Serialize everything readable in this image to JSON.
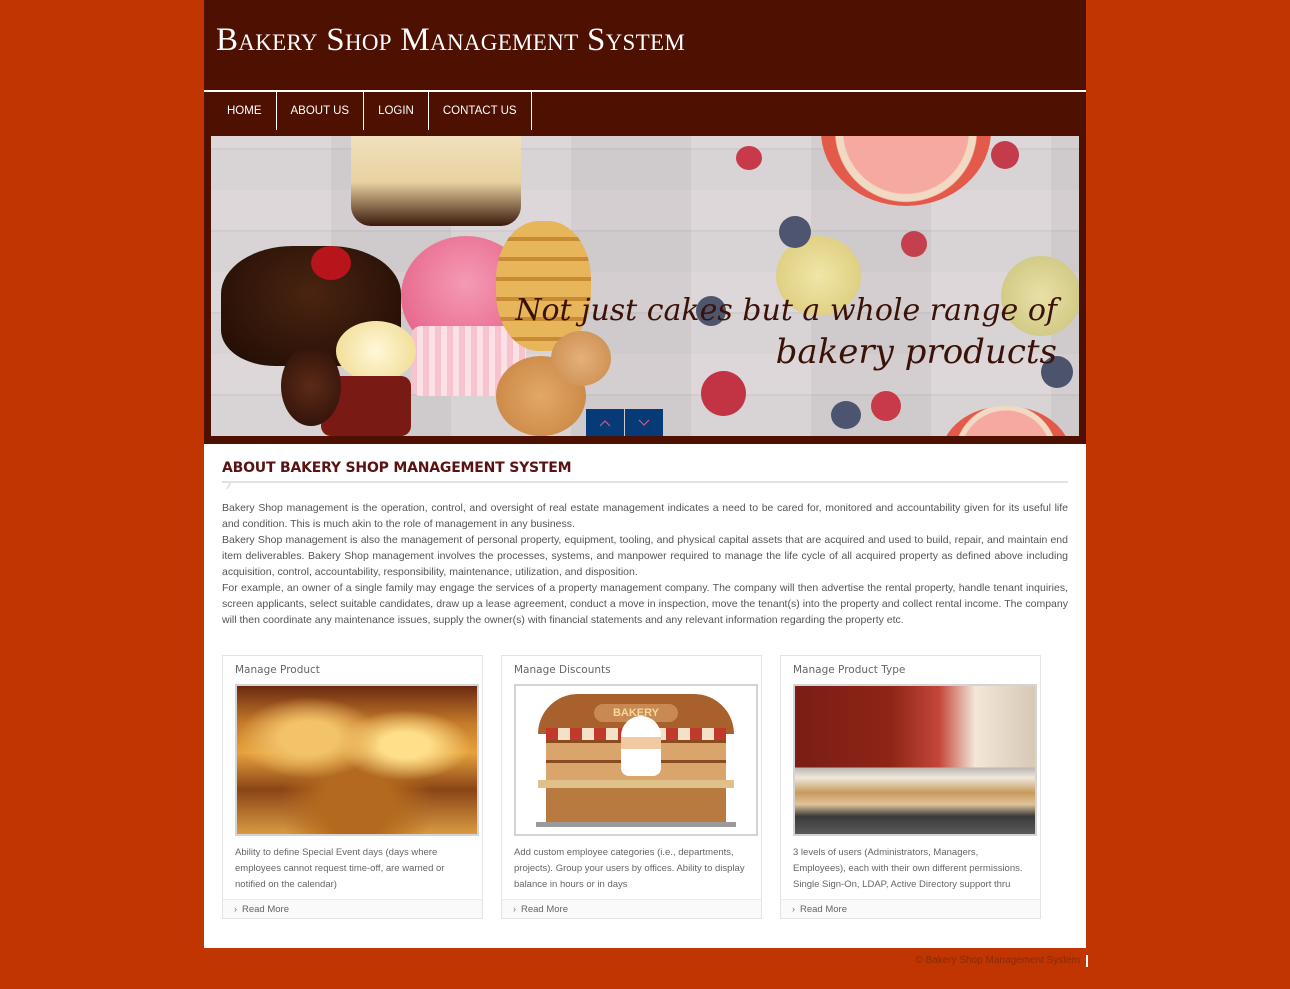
{
  "header": {
    "title": "Bakery Shop Management System"
  },
  "nav": {
    "items": [
      {
        "label": "HOME"
      },
      {
        "label": "ABOUT US"
      },
      {
        "label": "LOGIN"
      },
      {
        "label": "CONTACT US"
      }
    ]
  },
  "banner": {
    "caption_line1": "Not just cakes but a whole range of",
    "caption_line2": "bakery products",
    "prev_icon": "chevron-up-icon",
    "next_icon": "chevron-down-icon"
  },
  "about": {
    "title": "ABOUT BAKERY SHOP MANAGEMENT SYSTEM",
    "paragraphs": [
      "Bakery Shop management is the operation, control, and oversight of real estate management indicates a need to be cared for, monitored and accountability given for its useful life and condition. This is much akin to the role of management in any business.",
      "Bakery Shop management is also the management of personal property, equipment, tooling, and physical capital assets that are acquired and used to build, repair, and maintain end item deliverables. Bakery Shop management involves the processes, systems, and manpower required to manage the life cycle of all acquired property as defined above including acquisition, control, accountability, responsibility, maintenance, utilization, and disposition.",
      "For example, an owner of a single family may engage the services of a property management company. The company will then advertise the rental property, handle tenant inquiries, screen applicants, select suitable candidates, draw up a lease agreement, conduct a move in inspection, move the tenant(s) into the property and collect rental income. The company will then coordinate any maintenance issues, supply the owner(s) with financial statements and any relevant information regarding the property etc."
    ]
  },
  "cards": [
    {
      "title": "Manage Product",
      "description": "Ability to define Special Event days (days where employees cannot request time-off, are warned or notified on the calendar)",
      "link": "Read More"
    },
    {
      "title": "Manage Discounts",
      "description": "Add custom employee categories (i.e., departments, projects). Group your users by offices. Ability to display balance in hours or in days",
      "link": "Read More",
      "image_sign": "BAKERY"
    },
    {
      "title": "Manage Product Type",
      "description": "3 levels of users (Administrators, Managers, Employees), each with their own different permissions. Single Sign-On, LDAP, Active Directory support thru",
      "link": "Read More"
    }
  ],
  "footer": {
    "copyright": "© Bakery Shop Management System"
  },
  "colors": {
    "page_background": "#c13501",
    "header_background": "#4e1000",
    "slider_button": "#063b78",
    "section_title": "#5a1212"
  }
}
